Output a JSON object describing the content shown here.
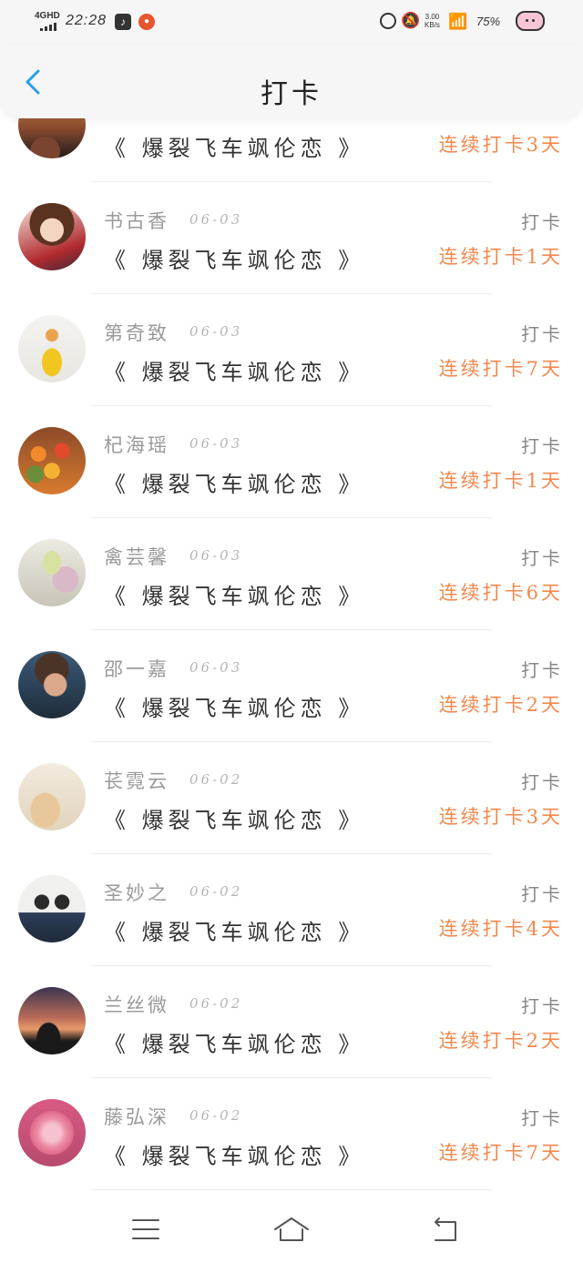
{
  "status_bar": {
    "network": "4GHD",
    "time": "22:28",
    "speed_top": "3.00",
    "speed_bottom": "KB/s",
    "battery": "75%"
  },
  "header": {
    "title": "打卡",
    "back_icon": "chevron-left-icon",
    "accent_color": "#2a9de8"
  },
  "colors": {
    "streak": "#ef8a4e",
    "name": "#9a9a9a",
    "book": "#333333"
  },
  "feed": [
    {
      "name": "",
      "date": "",
      "action": "",
      "book": "《 爆裂飞车飒伦恋 》",
      "streak": "连续打卡3天"
    },
    {
      "name": "书古香",
      "date": "06-03",
      "action": "打卡",
      "book": "《 爆裂飞车飒伦恋 》",
      "streak": "连续打卡1天"
    },
    {
      "name": "第奇致",
      "date": "06-03",
      "action": "打卡",
      "book": "《 爆裂飞车飒伦恋 》",
      "streak": "连续打卡7天"
    },
    {
      "name": "杞海瑶",
      "date": "06-03",
      "action": "打卡",
      "book": "《 爆裂飞车飒伦恋 》",
      "streak": "连续打卡1天"
    },
    {
      "name": "禽芸馨",
      "date": "06-03",
      "action": "打卡",
      "book": "《 爆裂飞车飒伦恋 》",
      "streak": "连续打卡6天"
    },
    {
      "name": "邵一嘉",
      "date": "06-03",
      "action": "打卡",
      "book": "《 爆裂飞车飒伦恋 》",
      "streak": "连续打卡2天"
    },
    {
      "name": "苌霓云",
      "date": "06-02",
      "action": "打卡",
      "book": "《 爆裂飞车飒伦恋 》",
      "streak": "连续打卡3天"
    },
    {
      "name": "圣妙之",
      "date": "06-02",
      "action": "打卡",
      "book": "《 爆裂飞车飒伦恋 》",
      "streak": "连续打卡4天"
    },
    {
      "name": "兰丝微",
      "date": "06-02",
      "action": "打卡",
      "book": "《 爆裂飞车飒伦恋 》",
      "streak": "连续打卡2天"
    },
    {
      "name": "藤弘深",
      "date": "06-02",
      "action": "打卡",
      "book": "《 爆裂飞车飒伦恋 》",
      "streak": "连续打卡7天"
    }
  ],
  "nav": {
    "menu_icon": "menu-icon",
    "home_icon": "home-icon",
    "back_icon": "back-icon"
  }
}
